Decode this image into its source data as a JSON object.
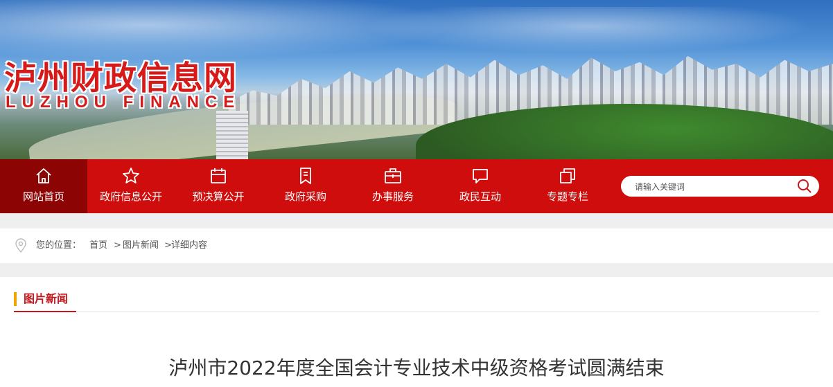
{
  "site": {
    "title": "泸州财政信息网",
    "subtitle": "LUZHOU FINANCE"
  },
  "nav": {
    "items": [
      {
        "label": "网站首页",
        "icon": "home-icon",
        "active": true
      },
      {
        "label": "政府信息公开",
        "icon": "star-icon"
      },
      {
        "label": "预决算公开",
        "icon": "calendar-icon"
      },
      {
        "label": "政府采购",
        "icon": "document-icon"
      },
      {
        "label": "办事服务",
        "icon": "briefcase-icon"
      },
      {
        "label": "政民互动",
        "icon": "chat-icon"
      },
      {
        "label": "专题专栏",
        "icon": "copy-icon"
      }
    ],
    "search_placeholder": "请输入关键词"
  },
  "breadcrumb": {
    "prefix": "您的位置：",
    "home": "首页",
    "separator1": ">",
    "section": "图片新闻",
    "separator2": ">",
    "current": "详细内容"
  },
  "section": {
    "title": "图片新闻"
  },
  "article": {
    "title": "泸州市2022年度全国会计专业技术中级资格考试圆满结束"
  },
  "colors": {
    "nav_red": "#d00d0d",
    "nav_active": "#8c0404",
    "title_red": "#d61919",
    "section_red": "#c4161c",
    "accent_bar": "#f0a400"
  }
}
